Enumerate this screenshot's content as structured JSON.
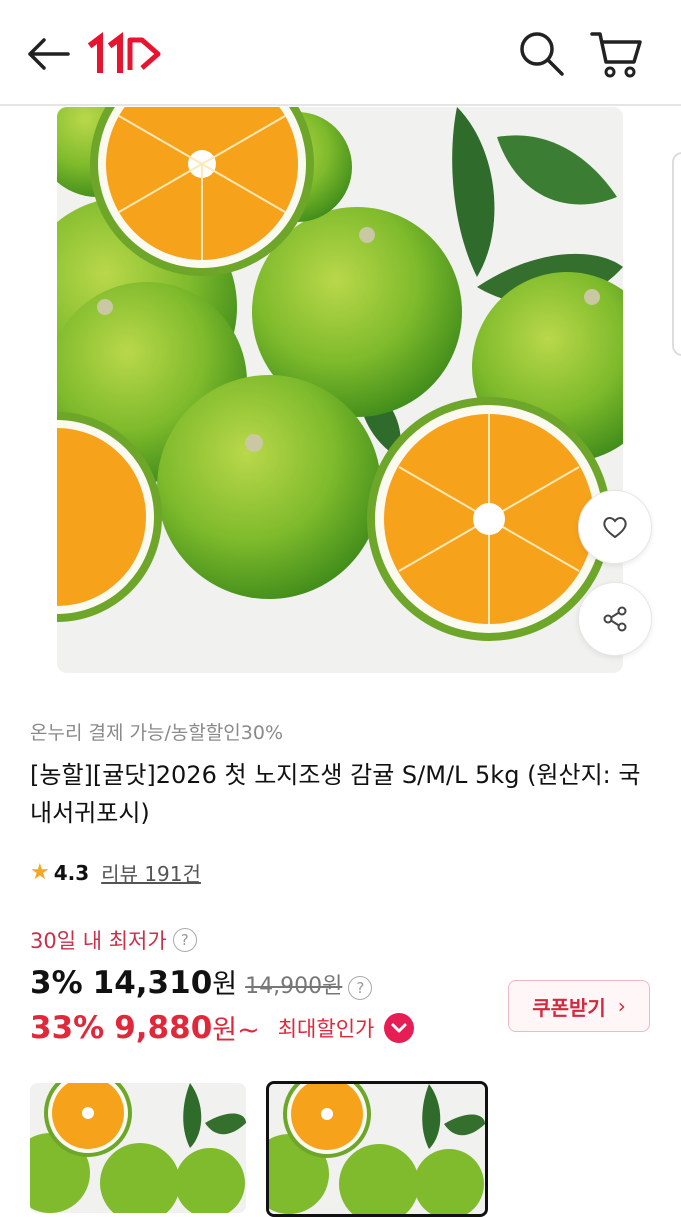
{
  "header": {
    "back_icon": "arrow-left-icon",
    "logo_text": "11",
    "search_icon": "search-icon",
    "cart_icon": "cart-icon",
    "brand_color": "#e8132f"
  },
  "product": {
    "promo": "온누리 결제 가능/농할할인30%",
    "title": "[농할][귤닷]2026 첫 노지조생 감귤 S/M/L 5kg (원산지: 국내서귀포시)",
    "rating": "4.3",
    "reviews": "리뷰 191건",
    "lowest_label": "30일 내 최저가",
    "price1": {
      "discount": "3%",
      "amount": "14,310",
      "won": "원",
      "original": "14,900원"
    },
    "price2": {
      "discount": "33%",
      "amount": "9,880",
      "won": "원~",
      "max_label": "최대할인가"
    },
    "coupon_label": "쿠폰받기",
    "accent_color": "#e0283a"
  },
  "actions": {
    "like_icon": "heart-icon",
    "share_icon": "share-icon"
  }
}
